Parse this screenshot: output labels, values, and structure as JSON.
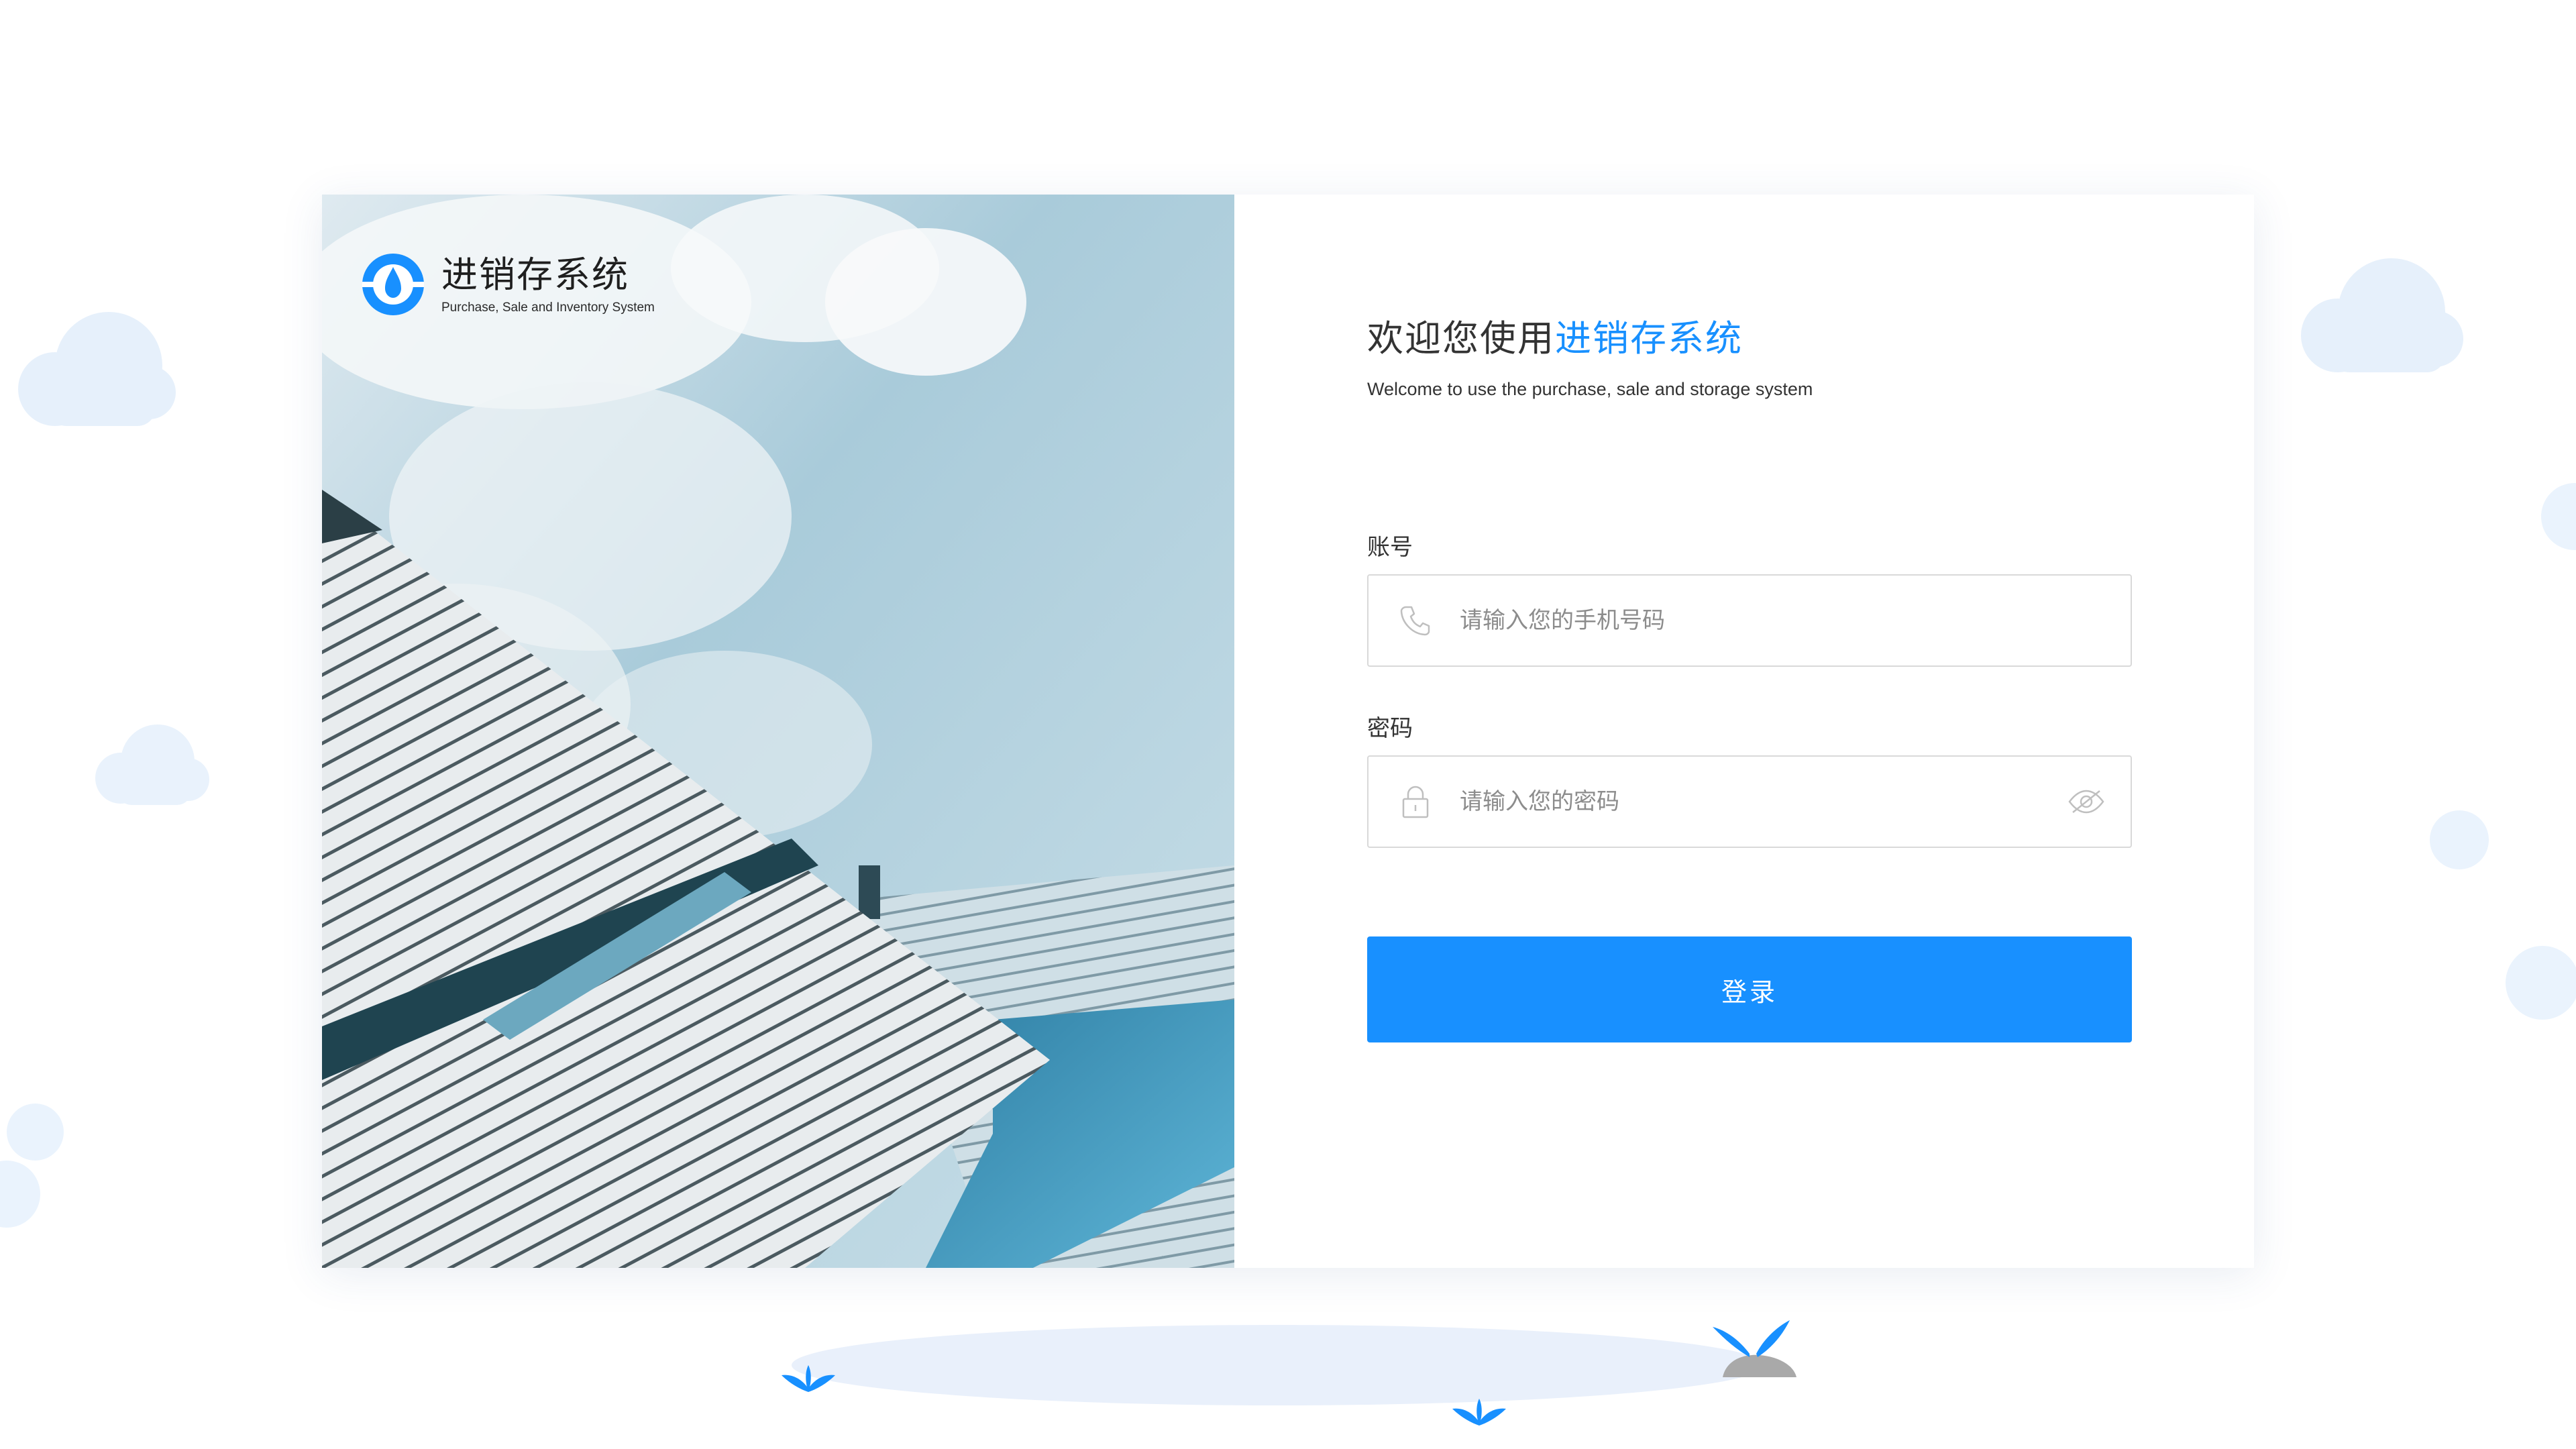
{
  "brand": {
    "title": "进销存系统",
    "subtitle": "Purchase, Sale and Inventory System"
  },
  "welcome": {
    "prefix": "欢迎您使用",
    "highlight": "进销存系统",
    "subtitle_en": "Welcome to use the purchase, sale and storage system"
  },
  "account": {
    "label": "账号",
    "placeholder": "请输入您的手机号码",
    "icon": "phone-icon"
  },
  "password": {
    "label": "密码",
    "placeholder": "请输入您的密码",
    "icon": "lock-icon",
    "toggle_icon": "eye-off-icon"
  },
  "login_button": {
    "label": "登录"
  },
  "colors": {
    "accent": "#1890ff",
    "text": "#333333",
    "border": "#d9d9d9",
    "placeholder": "#8c8c8c"
  }
}
